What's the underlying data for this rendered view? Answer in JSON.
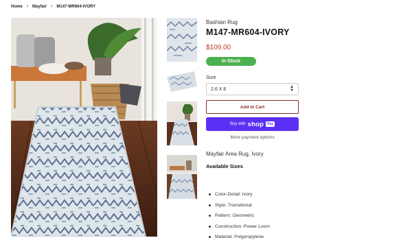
{
  "breadcrumb": {
    "home": "Home",
    "collection": "Mayfair",
    "current": "M147-MR604-IVORY"
  },
  "product": {
    "vendor": "Bashian Rug",
    "title": "M147-MR604-IVORY",
    "price": "$109.00",
    "stock_badge": "In Stock",
    "size_label": "Size",
    "size_selected": "2.6 X 8",
    "add_to_cart": "Add to Cart",
    "buy_with": "Buy with",
    "shop_word": "shop",
    "pay_badge": "Pay",
    "more_payment": "More payment options",
    "description_title": "Mayfair Area Rug, Ivory",
    "available_sizes": "Available Sizes",
    "features": [
      "Color-Detail: Ivory",
      "Style: Transitional",
      "Pattern: Geometric",
      "Construction: Power Loom",
      "Material: Polypropylene"
    ]
  },
  "colors": {
    "price": "#c0392b",
    "stock": "#4caf50",
    "shop_pay": "#5a31f4",
    "cart_border": "#8b2c2c"
  },
  "images": {
    "main": "rug-room-photo",
    "thumbs": [
      "rug-closeup",
      "rug-rolled-corner",
      "rug-hallway",
      "rug-room-wide"
    ]
  }
}
